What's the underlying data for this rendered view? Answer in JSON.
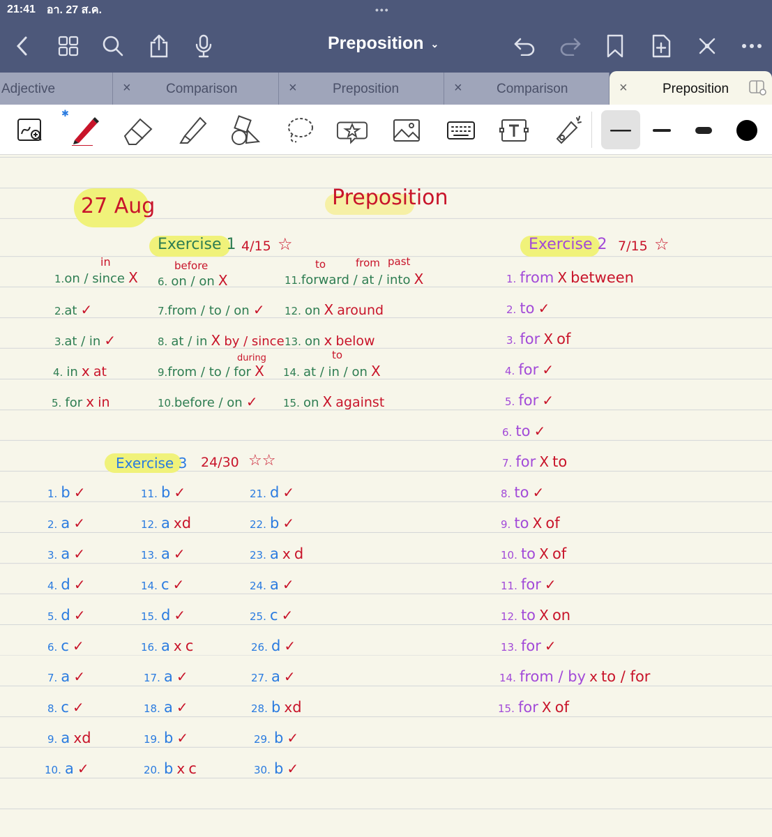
{
  "status": {
    "time": "21:41",
    "date": "อา. 27 ส.ค.",
    "dots": "•••"
  },
  "toolbar": {
    "title": "Preposition",
    "title_chevron": "⌄"
  },
  "tabs": [
    {
      "label": "Adjective",
      "close": "×"
    },
    {
      "label": "Comparison",
      "close": "×"
    },
    {
      "label": "Preposition",
      "close": "×"
    },
    {
      "label": "Comparison",
      "close": "×"
    },
    {
      "label": "Preposition",
      "close": "×"
    }
  ],
  "colors": {
    "nav_bg": "#4d587a",
    "paper": "#f7f6ea",
    "green_ink": "#2e7d52",
    "red_ink": "#c8142a",
    "blue_ink": "#2a7be0",
    "purple_ink": "#a24ad8",
    "highlight": "#f0f27a"
  },
  "note": {
    "date": "27 Aug",
    "title": "Preposition",
    "exercise1": {
      "label": "Exercise 1",
      "score": "4/15",
      "star": "☆",
      "rows": [
        {
          "n": "1.",
          "text": "on / since",
          "mark": "X",
          "fix": "in"
        },
        {
          "n": "2.",
          "text": "at",
          "mark": "✓",
          "fix": ""
        },
        {
          "n": "3.",
          "text": "at / in",
          "mark": "✓",
          "fix": ""
        },
        {
          "n": "4.",
          "text": "in",
          "mark": "x",
          "fix": "at"
        },
        {
          "n": "5.",
          "text": "for",
          "mark": "x",
          "fix": "in"
        },
        {
          "n": "6.",
          "text": "on / on",
          "mark": "X",
          "fix": "before"
        },
        {
          "n": "7.",
          "text": "from / to / on",
          "mark": "✓",
          "fix": ""
        },
        {
          "n": "8.",
          "text": "at / in",
          "mark": "X",
          "fix": "by / since"
        },
        {
          "n": "9.",
          "text": "from / to / for",
          "mark": "X",
          "fix": "during"
        },
        {
          "n": "10.",
          "text": "before / on",
          "mark": "✓",
          "fix": ""
        },
        {
          "n": "11.",
          "text": "forward / at / into",
          "mark": "X",
          "fix": "to",
          "fix2": "from",
          "fix3": "past"
        },
        {
          "n": "12.",
          "text": "on",
          "mark": "X",
          "fix": "around"
        },
        {
          "n": "13.",
          "text": "on",
          "mark": "x",
          "fix": "below"
        },
        {
          "n": "14.",
          "text": "at / in / on",
          "mark": "X",
          "fix": "to"
        },
        {
          "n": "15.",
          "text": "on",
          "mark": "X",
          "fix": "against"
        }
      ]
    },
    "exercise2": {
      "label": "Exercise 2",
      "score": "7/15",
      "star": "☆",
      "rows": [
        {
          "n": "1.",
          "text": "from",
          "mark": "X",
          "fix": "between"
        },
        {
          "n": "2.",
          "text": "to",
          "mark": "✓",
          "fix": ""
        },
        {
          "n": "3.",
          "text": "for",
          "mark": "X",
          "fix": "of"
        },
        {
          "n": "4.",
          "text": "for",
          "mark": "✓",
          "fix": ""
        },
        {
          "n": "5.",
          "text": "for",
          "mark": "✓",
          "fix": ""
        },
        {
          "n": "6.",
          "text": "to",
          "mark": "✓",
          "fix": ""
        },
        {
          "n": "7.",
          "text": "for",
          "mark": "X",
          "fix": "to"
        },
        {
          "n": "8.",
          "text": "to",
          "mark": "✓",
          "fix": ""
        },
        {
          "n": "9.",
          "text": "to",
          "mark": "X",
          "fix": "of"
        },
        {
          "n": "10.",
          "text": "to",
          "mark": "X",
          "fix": "of"
        },
        {
          "n": "11.",
          "text": "for",
          "mark": "✓",
          "fix": ""
        },
        {
          "n": "12.",
          "text": "to",
          "mark": "X",
          "fix": "on"
        },
        {
          "n": "13.",
          "text": "for",
          "mark": "✓",
          "fix": ""
        },
        {
          "n": "14.",
          "text": "from / by",
          "mark": "x",
          "fix": "to / for"
        },
        {
          "n": "15.",
          "text": "for",
          "mark": "X",
          "fix": "of"
        }
      ]
    },
    "exercise3": {
      "label": "Exercise 3",
      "score": "24/30",
      "stars": "☆☆",
      "rows": [
        {
          "n": "1.",
          "a": "b",
          "mark": "✓",
          "fix": ""
        },
        {
          "n": "2.",
          "a": "a",
          "mark": "✓",
          "fix": ""
        },
        {
          "n": "3.",
          "a": "a",
          "mark": "✓",
          "fix": ""
        },
        {
          "n": "4.",
          "a": "d",
          "mark": "✓",
          "fix": ""
        },
        {
          "n": "5.",
          "a": "d",
          "mark": "✓",
          "fix": ""
        },
        {
          "n": "6.",
          "a": "c",
          "mark": "✓",
          "fix": ""
        },
        {
          "n": "7.",
          "a": "a",
          "mark": "✓",
          "fix": ""
        },
        {
          "n": "8.",
          "a": "c",
          "mark": "✓",
          "fix": ""
        },
        {
          "n": "9.",
          "a": "a",
          "mark": "x",
          "fix": "d"
        },
        {
          "n": "10.",
          "a": "a",
          "mark": "✓",
          "fix": ""
        },
        {
          "n": "11.",
          "a": "b",
          "mark": "✓",
          "fix": ""
        },
        {
          "n": "12.",
          "a": "a",
          "mark": "x",
          "fix": "d"
        },
        {
          "n": "13.",
          "a": "a",
          "mark": "✓",
          "fix": ""
        },
        {
          "n": "14.",
          "a": "c",
          "mark": "✓",
          "fix": ""
        },
        {
          "n": "15.",
          "a": "d",
          "mark": "✓",
          "fix": ""
        },
        {
          "n": "16.",
          "a": "a",
          "mark": "x",
          "fix": "c"
        },
        {
          "n": "17.",
          "a": "a",
          "mark": "✓",
          "fix": ""
        },
        {
          "n": "18.",
          "a": "a",
          "mark": "✓",
          "fix": ""
        },
        {
          "n": "19.",
          "a": "b",
          "mark": "✓",
          "fix": ""
        },
        {
          "n": "20.",
          "a": "b",
          "mark": "x",
          "fix": "c"
        },
        {
          "n": "21.",
          "a": "d",
          "mark": "✓",
          "fix": ""
        },
        {
          "n": "22.",
          "a": "b",
          "mark": "✓",
          "fix": ""
        },
        {
          "n": "23.",
          "a": "a",
          "mark": "x",
          "fix": "d"
        },
        {
          "n": "24.",
          "a": "a",
          "mark": "✓",
          "fix": ""
        },
        {
          "n": "25.",
          "a": "c",
          "mark": "✓",
          "fix": ""
        },
        {
          "n": "26.",
          "a": "d",
          "mark": "✓",
          "fix": ""
        },
        {
          "n": "27.",
          "a": "a",
          "mark": "✓",
          "fix": ""
        },
        {
          "n": "28.",
          "a": "b",
          "mark": "x",
          "fix": "d"
        },
        {
          "n": "29.",
          "a": "b",
          "mark": "✓",
          "fix": ""
        },
        {
          "n": "30.",
          "a": "b",
          "mark": "✓",
          "fix": ""
        }
      ]
    }
  }
}
